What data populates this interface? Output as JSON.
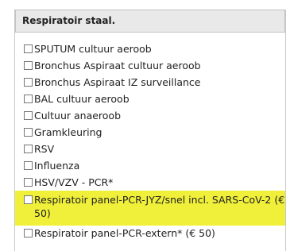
{
  "section": {
    "title": "Respiratoir staal."
  },
  "items": [
    {
      "label": "SPUTUM cultuur aeroob",
      "checked": false
    },
    {
      "label": "Bronchus Aspiraat cultuur aeroob",
      "checked": false
    },
    {
      "label": "Bronchus Aspiraat IZ surveillance",
      "checked": false
    },
    {
      "label": "BAL cultuur aeroob",
      "checked": false
    },
    {
      "label": "Cultuur anaeroob",
      "checked": false
    },
    {
      "label": "Gramkleuring",
      "checked": false
    },
    {
      "label": "RSV",
      "checked": false
    },
    {
      "label": "Influenza",
      "checked": false
    },
    {
      "label": "HSV/VZV - PCR*",
      "checked": false
    },
    {
      "label": "Respiratoir panel-PCR-JYZ/snel incl. SARS-CoV-2 (€ 50)",
      "checked": false,
      "highlighted": true
    },
    {
      "label": "Respiratoir panel-PCR-extern* (€ 50)",
      "checked": false
    }
  ],
  "colors": {
    "highlight": "#f0f03a",
    "header_bg": "#e9e9e9"
  }
}
